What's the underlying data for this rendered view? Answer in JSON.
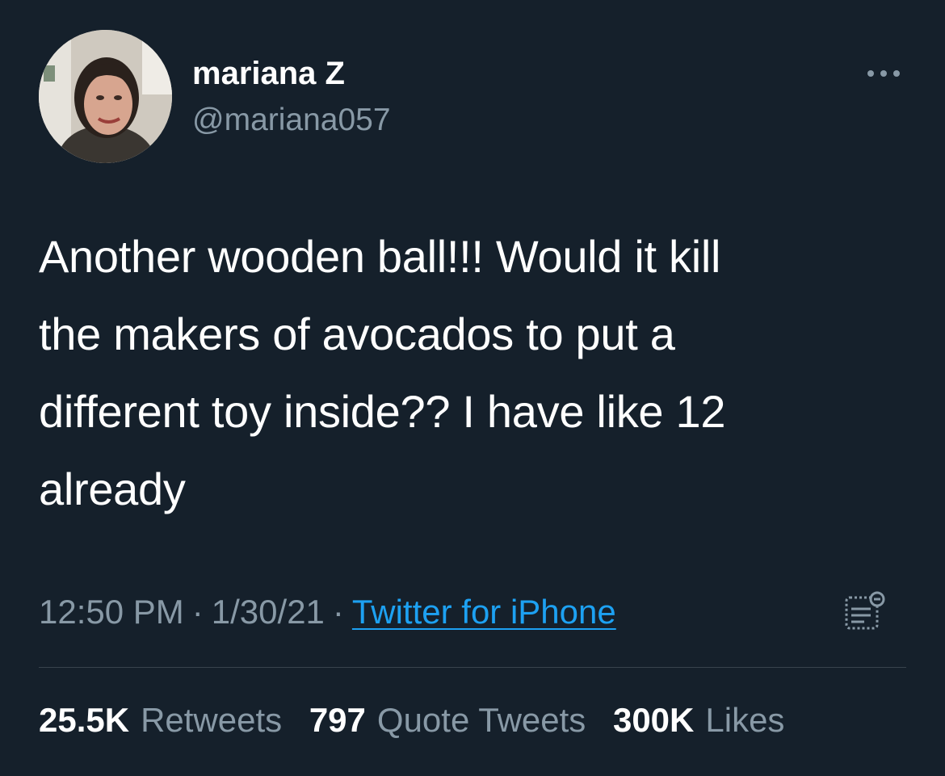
{
  "tweet": {
    "author": {
      "display_name": "mariana Z",
      "handle": "@mariana057",
      "avatar_icon": "profile-photo"
    },
    "more_icon": "more-dots-icon",
    "text": "Another wooden ball!!! Would it kill\nthe makers of avocados to put a\ndifferent toy inside?? I have like 12\nalready",
    "time": "12:50 PM",
    "date": "1/30/21",
    "separator": "·",
    "source": "Twitter for iPhone",
    "analytics_icon": "analytics-icon",
    "stats": {
      "retweets_count": "25.5K",
      "retweets_label": "Retweets",
      "quote_tweets_count": "797",
      "quote_tweets_label": "Quote Tweets",
      "likes_count": "300K",
      "likes_label": "Likes"
    }
  },
  "colors": {
    "background": "#15202b",
    "primary_text": "#ffffff",
    "secondary_text": "#8899a6",
    "link": "#1da1f2",
    "divider": "#38444d"
  }
}
